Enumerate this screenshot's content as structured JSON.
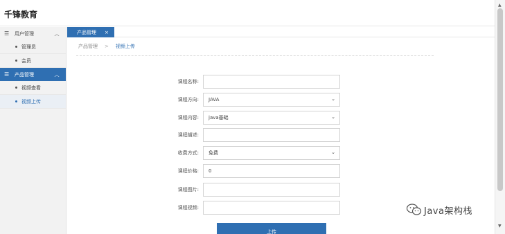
{
  "app": {
    "title": "千锋教育"
  },
  "sidebar": {
    "groups": [
      {
        "label": "用户管理",
        "items": [
          "管理员",
          "会员"
        ]
      },
      {
        "label": "产品管理",
        "items": [
          "视频查看",
          "视频上传"
        ]
      }
    ]
  },
  "tabs": [
    {
      "label": "产品管理",
      "close": "×"
    }
  ],
  "breadcrumb": {
    "parent": "产品管理",
    "separator": ">",
    "current": "视频上传"
  },
  "form": {
    "course_name": {
      "label": "课程名称:",
      "value": ""
    },
    "course_direction": {
      "label": "课程方向:",
      "value": "JAVA"
    },
    "course_content": {
      "label": "课程内容:",
      "value": "java基础"
    },
    "course_description": {
      "label": "课程描述:",
      "value": ""
    },
    "charge_mode": {
      "label": "收费方式:",
      "value": "免费"
    },
    "course_price": {
      "label": "课程价格:",
      "value": "0"
    },
    "course_image": {
      "label": "课程图片:",
      "value": ""
    },
    "course_video": {
      "label": "课程视频:",
      "value": ""
    },
    "submit_label": "上传"
  },
  "watermark": {
    "text": "Java架构栈"
  },
  "colors": {
    "accent": "#2f6fb2",
    "sidebar_bg": "#f2f2f2"
  },
  "icons": {
    "menu": "list-icon",
    "expand": "chevron-up-icon",
    "select": "chevron-down-icon",
    "watermark": "wechat-icon"
  }
}
